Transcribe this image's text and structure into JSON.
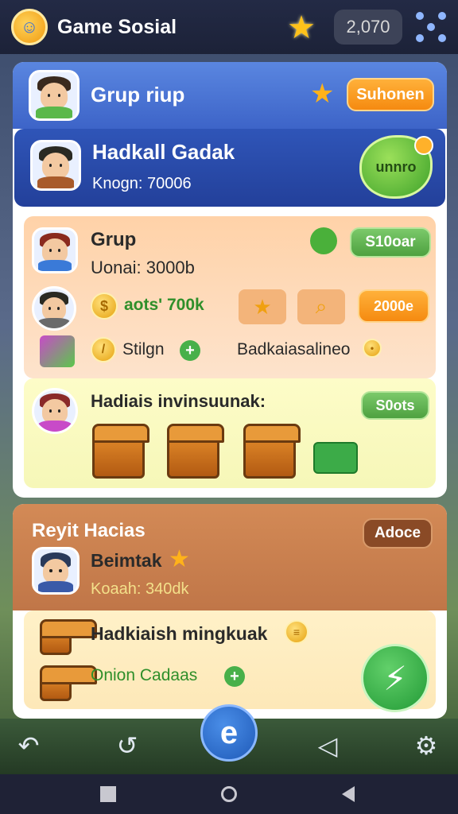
{
  "header": {
    "title": "Game Sosial",
    "coins": "2,070"
  },
  "card1": {
    "header": {
      "title": "Grup riup",
      "button": "Suhonen"
    },
    "blue": {
      "name": "Hadkall Gadak",
      "sub": "Knogn: 70006",
      "button": "unnro"
    },
    "peach": {
      "title": "Grup",
      "sub": "Uonai: 3000b",
      "button": "S10oar",
      "coin_text": "aots' 700k",
      "amount_button": "2000e",
      "stign_label": "Stilgn",
      "right_text": "Badkaiasalineo"
    },
    "yellow": {
      "title": "Hadiais invinsuunak:",
      "button": "S0ots"
    }
  },
  "card2": {
    "title": "Reyit Hacias",
    "button": "Adoce",
    "name": "Beimtak",
    "sub": "Koaah: 340dk",
    "row1": "Hadkiaish mingkuak",
    "row2": "Onion Cadaas"
  },
  "colors": {
    "accent_blue": "#3d64c8",
    "accent_orange": "#f58a10",
    "accent_green": "#4ea140"
  },
  "icons": [
    "game-logo-icon",
    "star-icon",
    "grid-menu-icon",
    "undo-icon",
    "redo-icon",
    "share-icon",
    "gear-icon",
    "edit-icon",
    "bolt-icon",
    "plus-icon"
  ]
}
